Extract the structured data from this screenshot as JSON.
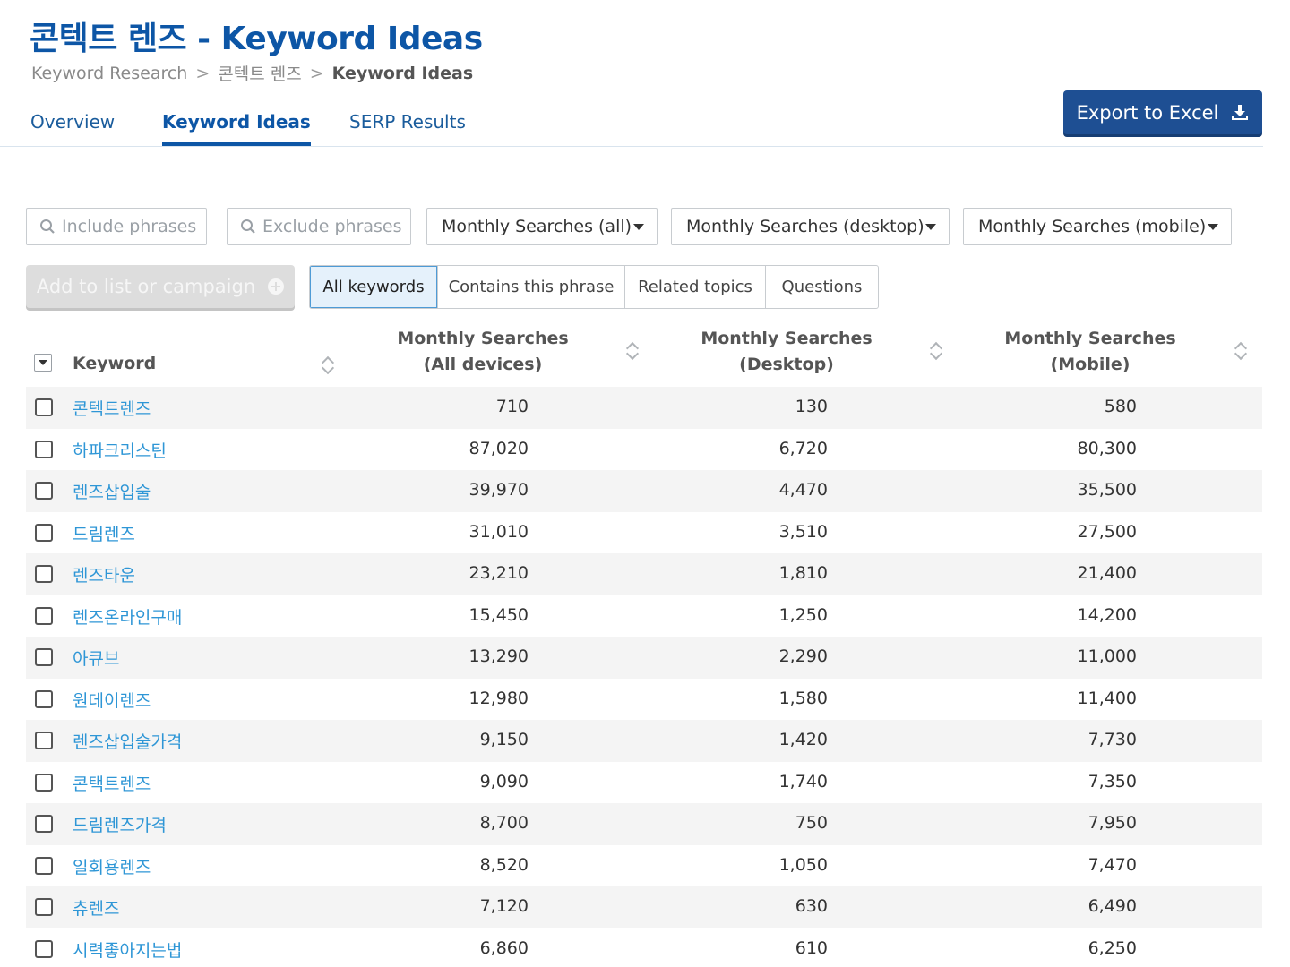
{
  "header": {
    "title": "콘텍트 렌즈 - Keyword Ideas",
    "breadcrumb": [
      "Keyword Research",
      "콘텍트 렌즈",
      "Keyword Ideas"
    ],
    "breadcrumb_sep": ">"
  },
  "tabs": [
    {
      "label": "Overview",
      "active": false
    },
    {
      "label": "Keyword Ideas",
      "active": true
    },
    {
      "label": "SERP Results",
      "active": false
    }
  ],
  "export_button": {
    "label": "Export to Excel",
    "icon": "download-icon"
  },
  "filters": {
    "include": {
      "placeholder": "Include phrases",
      "icon": "search-icon"
    },
    "exclude": {
      "placeholder": "Exclude phrases",
      "icon": "search-icon"
    },
    "all": "Monthly Searches (all)",
    "desktop": "Monthly Searches (desktop)",
    "mobile": "Monthly Searches (mobile)"
  },
  "add_button": {
    "label": "Add to list or campaign",
    "icon": "plus-circle-icon",
    "disabled": true
  },
  "segments": [
    {
      "label": "All keywords",
      "active": true
    },
    {
      "label": "Contains this phrase",
      "active": false
    },
    {
      "label": "Related topics",
      "active": false
    },
    {
      "label": "Questions",
      "active": false
    }
  ],
  "columns": {
    "keyword": "Keyword",
    "all_l1": "Monthly Searches",
    "all_l2": "(All devices)",
    "desk_l1": "Monthly Searches",
    "desk_l2": "(Desktop)",
    "mob_l1": "Monthly Searches",
    "mob_l2": "(Mobile)"
  },
  "rows": [
    {
      "keyword": "콘텍트렌즈",
      "all": "710",
      "desktop": "130",
      "mobile": "580"
    },
    {
      "keyword": "하파크리스틴",
      "all": "87,020",
      "desktop": "6,720",
      "mobile": "80,300"
    },
    {
      "keyword": "렌즈삽입술",
      "all": "39,970",
      "desktop": "4,470",
      "mobile": "35,500"
    },
    {
      "keyword": "드림렌즈",
      "all": "31,010",
      "desktop": "3,510",
      "mobile": "27,500"
    },
    {
      "keyword": "렌즈타운",
      "all": "23,210",
      "desktop": "1,810",
      "mobile": "21,400"
    },
    {
      "keyword": "렌즈온라인구매",
      "all": "15,450",
      "desktop": "1,250",
      "mobile": "14,200"
    },
    {
      "keyword": "아큐브",
      "all": "13,290",
      "desktop": "2,290",
      "mobile": "11,000"
    },
    {
      "keyword": "원데이렌즈",
      "all": "12,980",
      "desktop": "1,580",
      "mobile": "11,400"
    },
    {
      "keyword": "렌즈삽입술가격",
      "all": "9,150",
      "desktop": "1,420",
      "mobile": "7,730"
    },
    {
      "keyword": "콘택트렌즈",
      "all": "9,090",
      "desktop": "1,740",
      "mobile": "7,350"
    },
    {
      "keyword": "드림렌즈가격",
      "all": "8,700",
      "desktop": "750",
      "mobile": "7,950"
    },
    {
      "keyword": "일회용렌즈",
      "all": "8,520",
      "desktop": "1,050",
      "mobile": "7,470"
    },
    {
      "keyword": "츄렌즈",
      "all": "7,120",
      "desktop": "630",
      "mobile": "6,490"
    },
    {
      "keyword": "시력좋아지는법",
      "all": "6,860",
      "desktop": "610",
      "mobile": "6,250"
    }
  ]
}
